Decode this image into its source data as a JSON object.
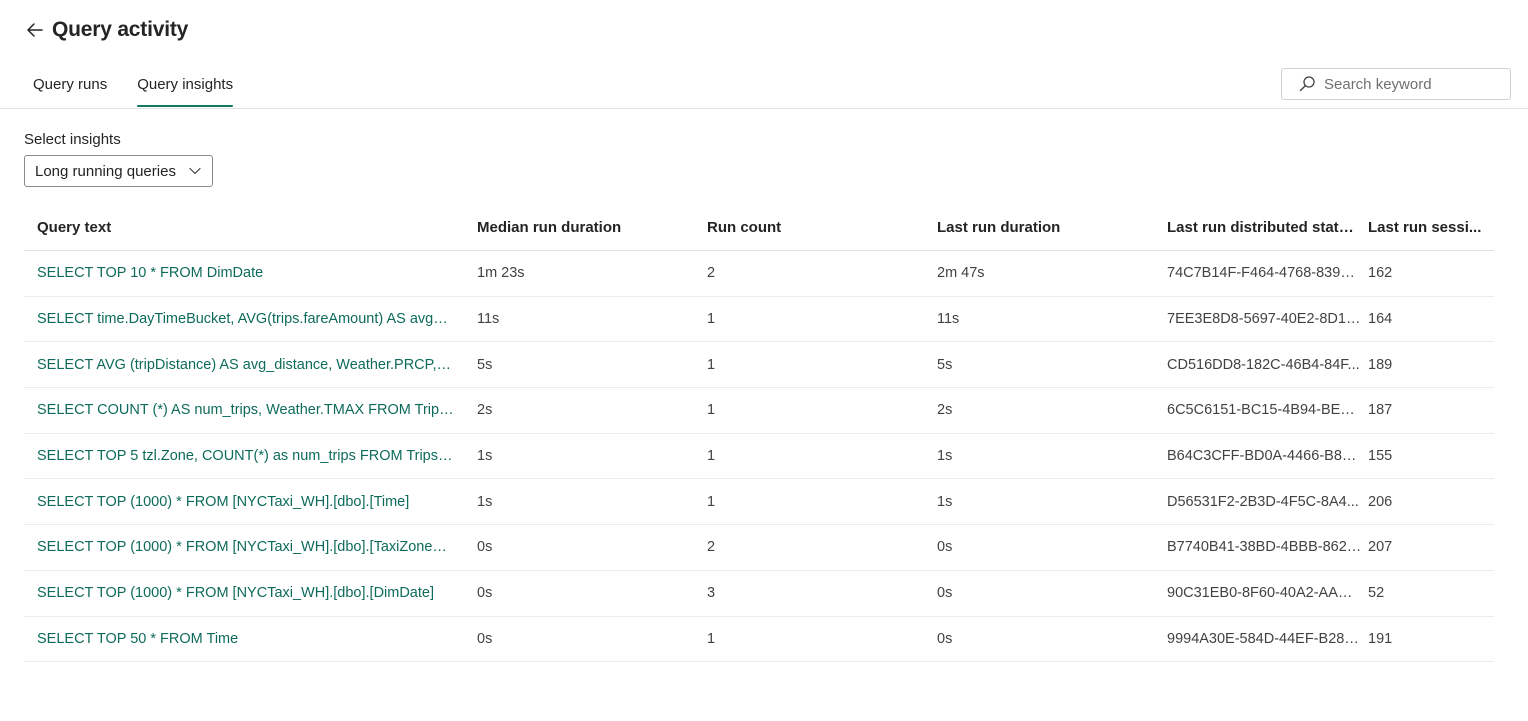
{
  "header": {
    "title": "Query activity"
  },
  "tabs": [
    {
      "label": "Query runs",
      "active": false
    },
    {
      "label": "Query insights",
      "active": true
    }
  ],
  "search": {
    "placeholder": "Search keyword",
    "value": ""
  },
  "insights": {
    "label": "Select insights",
    "selected": "Long running queries"
  },
  "table": {
    "columns": [
      "Query text",
      "Median run duration",
      "Run count",
      "Last run duration",
      "Last run distributed statem...",
      "Last run sessi..."
    ],
    "rows": [
      [
        "SELECT TOP 10 * FROM DimDate",
        "1m 23s",
        "2",
        "2m 47s",
        "74C7B14F-F464-4768-8395-...",
        "162"
      ],
      [
        "SELECT time.DayTimeBucket, AVG(trips.fareAmount) AS avg_far...",
        "11s",
        "1",
        "11s",
        "7EE3E8D8-5697-40E2-8D15...",
        "164"
      ],
      [
        "SELECT AVG (tripDistance) AS avg_distance, Weather.PRCP, CO...",
        "5s",
        "1",
        "5s",
        "CD516DD8-182C-46B4-84F...",
        "189"
      ],
      [
        "SELECT COUNT (*) AS num_trips, Weather.TMAX FROM Trips JO...",
        "2s",
        "1",
        "2s",
        "6C5C6151-BC15-4B94-BE4E...",
        "187"
      ],
      [
        "SELECT TOP 5 tzl.Zone, COUNT(*) as num_trips FROM Trips trip...",
        "1s",
        "1",
        "1s",
        "B64C3CFF-BD0A-4466-B83...",
        "155"
      ],
      [
        "SELECT TOP (1000) * FROM [NYCTaxi_WH].[dbo].[Time]",
        "1s",
        "1",
        "1s",
        "D56531F2-2B3D-4F5C-8A4...",
        "206"
      ],
      [
        "SELECT TOP (1000) * FROM [NYCTaxi_WH].[dbo].[TaxiZoneLook...",
        "0s",
        "2",
        "0s",
        "B7740B41-38BD-4BBB-8624...",
        "207"
      ],
      [
        "SELECT TOP (1000) * FROM [NYCTaxi_WH].[dbo].[DimDate]",
        "0s",
        "3",
        "0s",
        "90C31EB0-8F60-40A2-AACF...",
        "52"
      ],
      [
        "SELECT TOP 50 * FROM Time",
        "0s",
        "1",
        "0s",
        "9994A30E-584D-44EF-B28F...",
        "191"
      ]
    ]
  },
  "icons": {
    "back": "arrow-left-icon",
    "search": "search-icon",
    "dropdown": "chevron-down-icon"
  },
  "colors": {
    "accent": "#117865",
    "link": "#0e6b5b"
  }
}
